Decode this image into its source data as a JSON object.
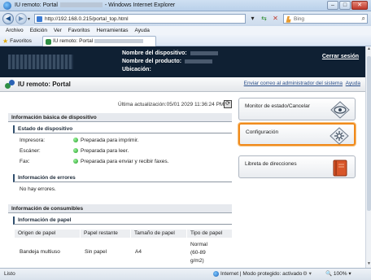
{
  "window": {
    "title_left": "IU remoto: Portal",
    "title_right": "- Windows Internet Explorer",
    "buttons": [
      "–",
      "□",
      "✕"
    ]
  },
  "address": {
    "url": "http://192.168.0.215/portal_top.html",
    "search_engine": "Bing"
  },
  "menu": [
    "Archivo",
    "Edición",
    "Ver",
    "Favoritos",
    "Herramientas",
    "Ayuda"
  ],
  "favorites": {
    "label": "Favoritos",
    "tab_title": "IU remoto: Portal"
  },
  "banner": {
    "device_name_label": "Nombre del dispositivo:",
    "product_name_label": "Nombre del producto:",
    "location_label": "Ubicación:",
    "logout": "Cerrar sesión"
  },
  "portal": {
    "title": "IU remoto: Portal",
    "mail_admin": "Enviar correo al administrador del sistema",
    "help": "Ayuda"
  },
  "last_update": "Última actualización:05/01 2029 11:36:24 PM",
  "basic_info": {
    "heading": "Información básica de dispositivo",
    "device_status": {
      "heading": "Estado de dispositivo",
      "rows": [
        {
          "label": "Impresora:",
          "value": "Preparada para imprimir."
        },
        {
          "label": "Escáner:",
          "value": "Preparada para leer."
        },
        {
          "label": "Fax:",
          "value": "Preparada para enviar y recibir faxes."
        }
      ]
    },
    "errors": {
      "heading": "Información de errores",
      "value": "No hay errores."
    }
  },
  "consumables": {
    "heading": "Información de consumibles",
    "paper": {
      "heading": "Información de papel",
      "columns": [
        "Origen de papel",
        "Papel restante",
        "Tamaño de papel",
        "Tipo de papel"
      ],
      "rows": [
        {
          "source": "Bandeja multiuso",
          "remaining": "Sin papel",
          "size": "A4",
          "type_lines": [
            "Normal",
            "(60-89",
            "g/m2)"
          ]
        }
      ]
    }
  },
  "side_panel": [
    {
      "label": "Monitor de estado/Cancelar",
      "icon": "eye-icon"
    },
    {
      "label": "Configuración",
      "icon": "settings-icon"
    },
    {
      "label": "Libreta de direcciones",
      "icon": "address-book-icon"
    }
  ],
  "status_bar": {
    "left": "Listo",
    "zone": "Internet | Modo protegido: activado",
    "zoom": "100%"
  },
  "colors": {
    "banner_bg": "#0f2033",
    "selected_outline": "#f08a1c",
    "status_green": "#1e9a24",
    "link_blue": "#2a4f8a"
  }
}
